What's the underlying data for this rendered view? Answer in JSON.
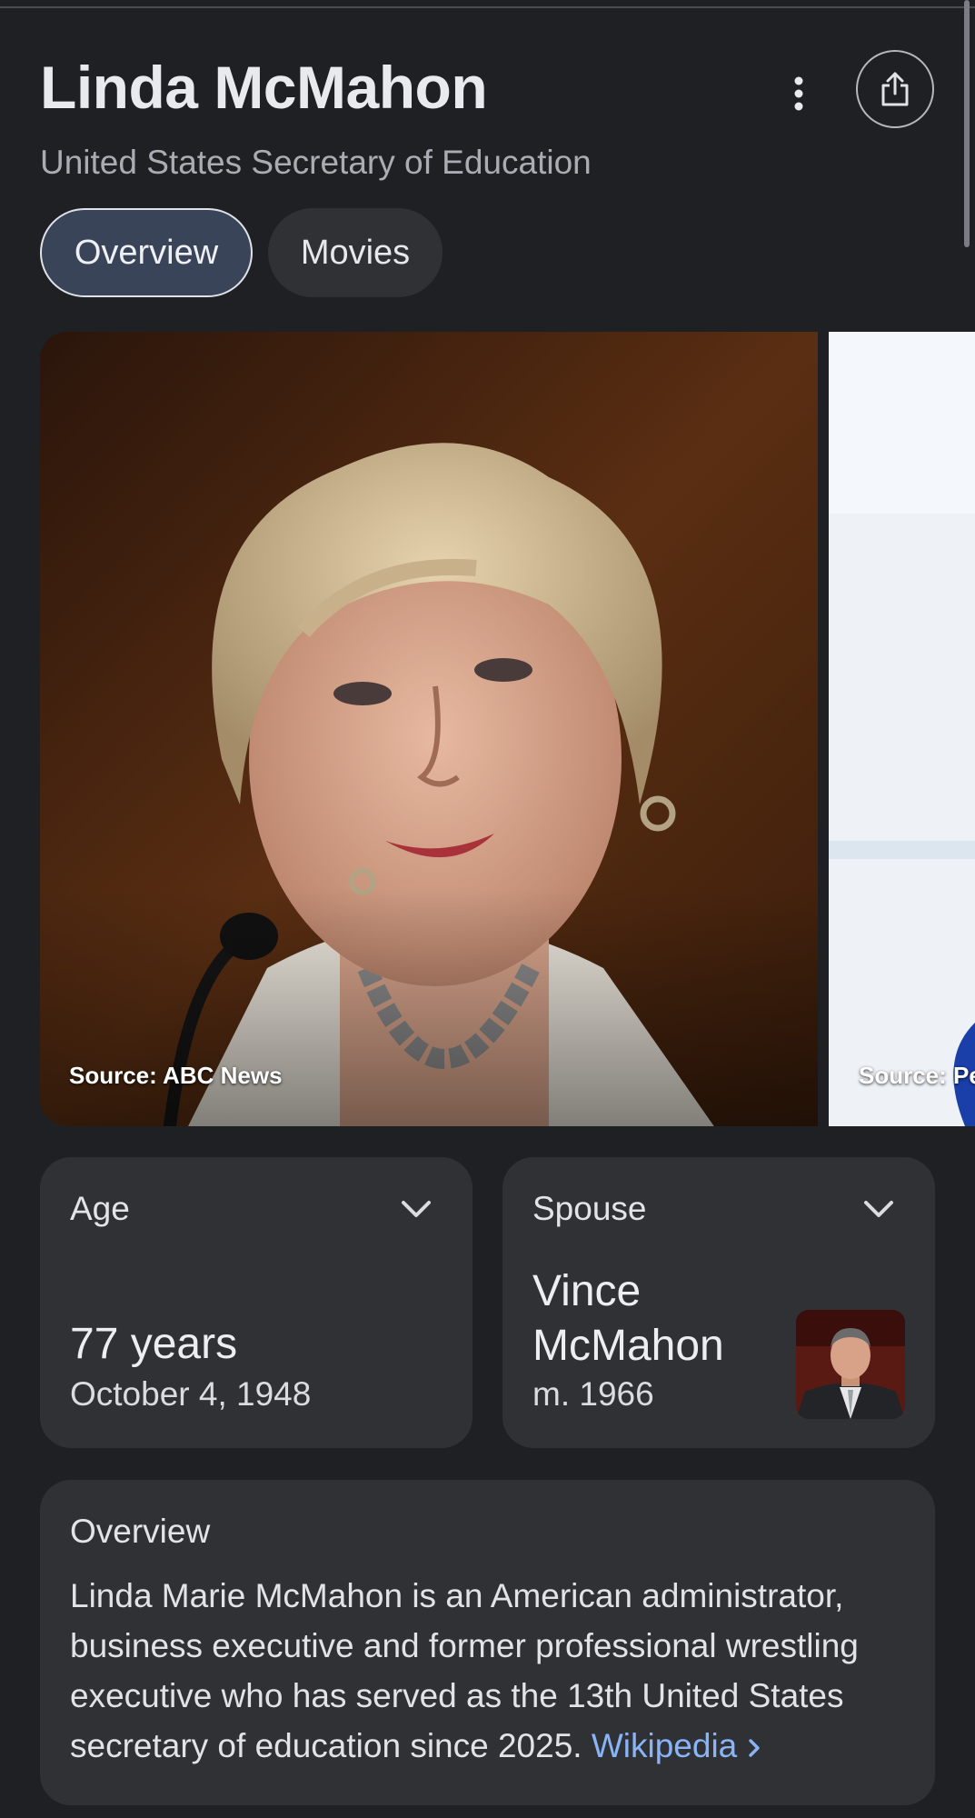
{
  "header": {
    "title": "Linda McMahon",
    "subtitle": "United States Secretary of Education"
  },
  "actions": {
    "more_icon": "more-vert-icon",
    "share_icon": "share-icon"
  },
  "tabs": [
    {
      "label": "Overview",
      "selected": true
    },
    {
      "label": "Movies",
      "selected": false
    }
  ],
  "images": [
    {
      "source": "Source: ABC News"
    },
    {
      "source": "Source: Pe"
    }
  ],
  "facts": {
    "age": {
      "label": "Age",
      "value": "77 years",
      "detail": "October 4, 1948"
    },
    "spouse": {
      "label": "Spouse",
      "name": "Vince McMahon",
      "detail": "m. 1966"
    }
  },
  "overview": {
    "heading": "Overview",
    "text": "Linda Marie McMahon is an American administrator, business executive and former professional wrestling executive who has served as the 13th United States secretary of education since 2025.",
    "link": "Wikipedia",
    "link_icon": "chevron-right-icon"
  },
  "colors": {
    "background": "#1f2024",
    "card": "#303135",
    "selected_tab": "#3a4459",
    "link": "#8ab4f8"
  }
}
